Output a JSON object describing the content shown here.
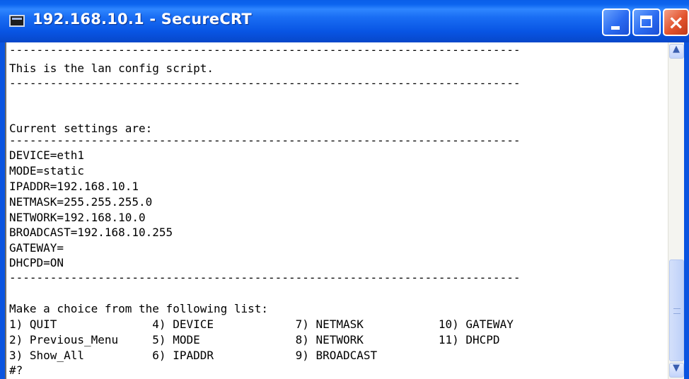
{
  "window": {
    "title": "192.168.10.1 - SecureCRT",
    "icon": "securecrt-terminal-icon",
    "controls": {
      "minimize": "minimize-icon",
      "maximize": "maximize-icon",
      "close": "×"
    }
  },
  "terminal": {
    "lines": [
      "---------------------------------------------------------------------------",
      "This is the lan config script.",
      "---------------------------------------------------------------------------",
      "",
      "",
      "Current settings are:",
      "---------------------------------------------------------------------------",
      "DEVICE=eth1",
      "MODE=static",
      "IPADDR=192.168.10.1",
      "NETMASK=255.255.255.0",
      "NETWORK=192.168.10.0",
      "BROADCAST=192.168.10.255",
      "GATEWAY=",
      "DHCPD=ON",
      "---------------------------------------------------------------------------",
      "",
      "Make a choice from the following list:",
      "1) QUIT              4) DEVICE            7) NETMASK           10) GATEWAY",
      "2) Previous_Menu     5) MODE              8) NETWORK           11) DHCPD",
      "3) Show_All          6) IPADDR            9) BROADCAST",
      "#?"
    ]
  },
  "scrollbar": {
    "up": "▲",
    "down": "▼",
    "position": 0.88
  },
  "colors": {
    "titlebar": "#0a5ee8",
    "terminal_bg": "#ffffff",
    "terminal_fg": "#000000"
  }
}
